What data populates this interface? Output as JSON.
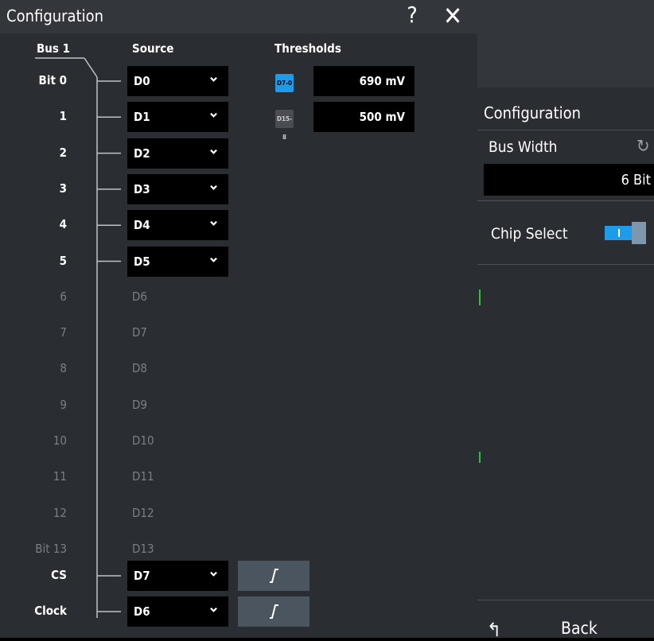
{
  "dialog": {
    "title": "Configuration",
    "help_label": "?",
    "close_label": "✕",
    "headers": {
      "bus": "Bus 1",
      "source": "Source",
      "thresholds": "Thresholds"
    },
    "bits": [
      {
        "label": "Bit 0",
        "source": "D0",
        "active": true
      },
      {
        "label": "1",
        "source": "D1",
        "active": true
      },
      {
        "label": "2",
        "source": "D2",
        "active": true
      },
      {
        "label": "3",
        "source": "D3",
        "active": true
      },
      {
        "label": "4",
        "source": "D4",
        "active": true
      },
      {
        "label": "5",
        "source": "D5",
        "active": true
      },
      {
        "label": "6",
        "source": "D6",
        "active": false
      },
      {
        "label": "7",
        "source": "D7",
        "active": false
      },
      {
        "label": "8",
        "source": "D8",
        "active": false
      },
      {
        "label": "9",
        "source": "D9",
        "active": false
      },
      {
        "label": "10",
        "source": "D10",
        "active": false
      },
      {
        "label": "11",
        "source": "D11",
        "active": false
      },
      {
        "label": "12",
        "source": "D12",
        "active": false
      },
      {
        "label": "Bit 13",
        "source": "D13",
        "active": false
      }
    ],
    "cs": {
      "label": "CS",
      "source": "D7"
    },
    "clock": {
      "label": "Clock",
      "source": "D6"
    },
    "thresholds": [
      {
        "icon": "D7-0",
        "value": "690 mV",
        "color": "#1e9be9"
      },
      {
        "icon": "D15-8",
        "value": "500 mV",
        "color": "#4a4e54"
      }
    ]
  },
  "panel": {
    "title": "Configuration",
    "bus_width_label": "Bus Width",
    "bus_width_value": "6 Bit",
    "chip_select_label": "Chip Select",
    "chip_select_on": true,
    "back_icon": "↰",
    "back_label": "Back"
  },
  "colors": {
    "accent": "#1e9be9",
    "dialog_bg": "#2a2d31",
    "edge_button": "#4b5560"
  }
}
